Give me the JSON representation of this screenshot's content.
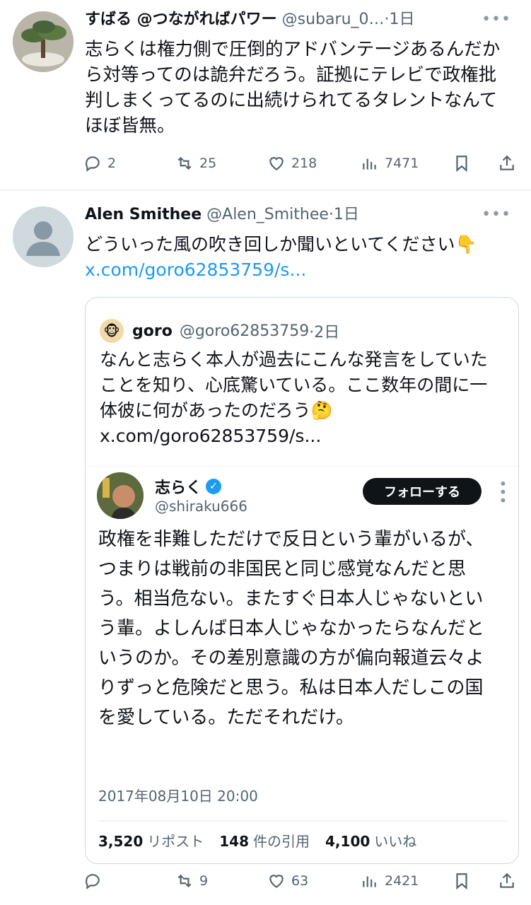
{
  "tweet1": {
    "name": "すばる @つながればパワー",
    "handle": "@subaru_0…",
    "time": "·1日",
    "text": "志らくは権力側で圧倒的アドバンテージあるんだから対等ってのは詭弁だろう。証拠にテレビで政権批判しまくってるのに出続けられてるタレントなんてほぼ皆無。",
    "replies": "2",
    "retweets": "25",
    "likes": "218",
    "views": "7471"
  },
  "tweet2": {
    "name": "Alen Smithee",
    "handle": "@Alen_Smithee",
    "time": "·1日",
    "text": "どういった風の吹き回しか聞いといてください",
    "emoji": "👇",
    "link": "x.com/goro62853759/s...",
    "replies": "",
    "retweets": "9",
    "likes": "63",
    "views": "2421"
  },
  "quote": {
    "avatar_emoji": "🐵",
    "name": "goro",
    "handle": "@goro62853759",
    "time": "·2日",
    "text": "なんと志らく本人が過去にこんな発言をしていたことを知り、心底驚いている。ここ数年の間に一体彼に何があったのだろう",
    "emoji": "🤔",
    "link": "x.com/goro62853759/s..."
  },
  "embed": {
    "name": "志らく",
    "handle": "@shiraku666",
    "follow_label": "フォローする",
    "text": "政権を非難しただけで反日という輩がいるが、つまりは戦前の非国民と同じ感覚なんだと思う。相当危ない。またすぐ日本人じゃないという輩。よしんば日本人じゃなかったらなんだというのか。その差別意識の方が偏向報道云々よりずっと危険だと思う。私は日本人だしこの国を愛している。ただそれだけ。",
    "date": "2017年08月10日 20:00",
    "reposts_count": "3,520",
    "reposts_label": "リポスト",
    "quotes_count": "148",
    "quotes_label": "件の引用",
    "likes_count": "4,100",
    "likes_label": "いいね"
  }
}
